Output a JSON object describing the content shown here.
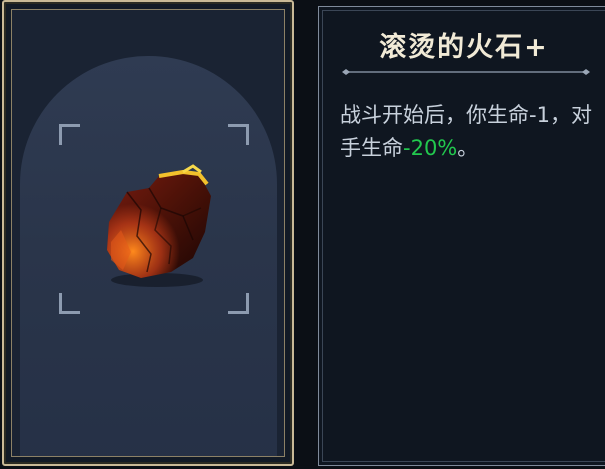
{
  "item_card": {
    "icon": "hot-flint-icon"
  },
  "detail_panel": {
    "title": "滚烫的火石+",
    "description": {
      "text_before": "战斗开始后，你生命-1，对手生命",
      "highlight": "-20%",
      "text_after": "。"
    }
  },
  "colors": {
    "card_border": "#c9b996",
    "halo": "#2f3b52",
    "title_text": "#f1ead6",
    "body_text": "#c8d1dc",
    "highlight_green": "#22c84e"
  }
}
